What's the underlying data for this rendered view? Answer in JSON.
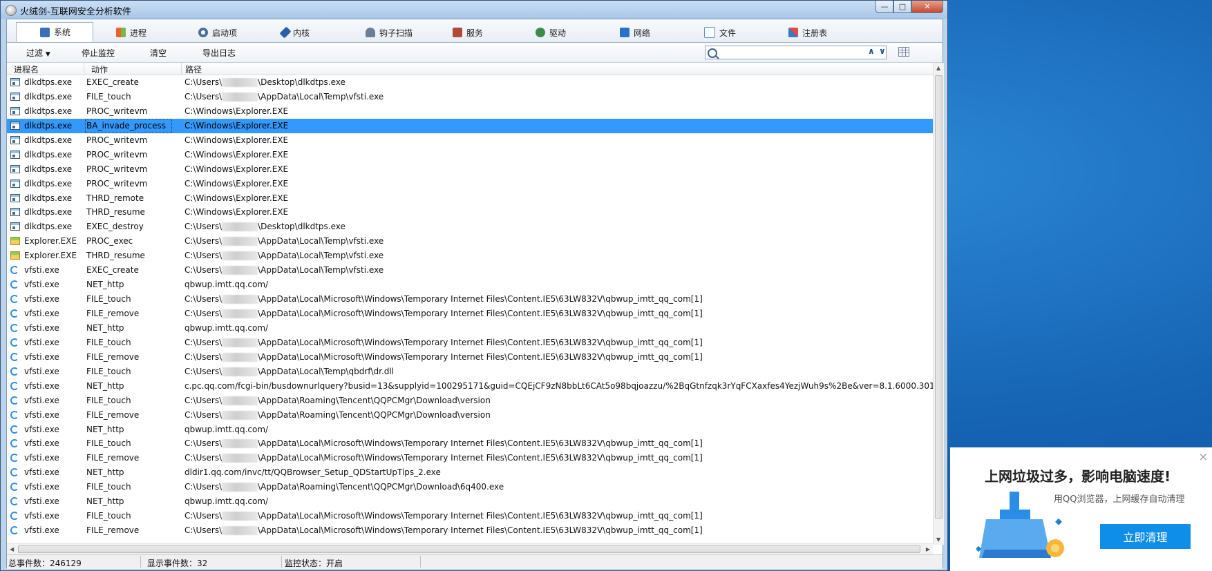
{
  "window": {
    "title": "火绒剑-互联网安全分析软件"
  },
  "tabs": [
    {
      "label": "系统",
      "icon": "system-icon",
      "color": "#3b6fb6"
    },
    {
      "label": "进程",
      "icon": "windows-logo-icon",
      "color": "#e8632a"
    },
    {
      "label": "启动项",
      "icon": "gear-icon",
      "color": "#4a6d9c"
    },
    {
      "label": "内核",
      "icon": "tools-icon",
      "color": "#2d5fa8"
    },
    {
      "label": "钩子扫描",
      "icon": "hook-scan-icon",
      "color": "#6a7f96"
    },
    {
      "label": "服务",
      "icon": "service-icon",
      "color": "#b04b3a"
    },
    {
      "label": "驱动",
      "icon": "driver-icon",
      "color": "#3e8a4a"
    },
    {
      "label": "网络",
      "icon": "network-icon",
      "color": "#2a72c4"
    },
    {
      "label": "文件",
      "icon": "file-icon",
      "color": "#5c8fc8"
    },
    {
      "label": "注册表",
      "icon": "registry-icon",
      "color": "#3a78c8"
    }
  ],
  "toolbar": {
    "filter_label": "过滤",
    "stop_label": "停止监控",
    "clear_label": "清空",
    "export_label": "导出日志",
    "search_value": "",
    "up_label": "∧",
    "down_label": "∨"
  },
  "columns": {
    "process": "进程名",
    "action": "动作",
    "path": "路径"
  },
  "rows": [
    {
      "icon": "exe",
      "proc": "dlkdtps.exe",
      "action": "EXEC_create",
      "path": [
        "C:\\Users\\",
        "\\Desktop\\dlkdtps.exe"
      ]
    },
    {
      "icon": "exe",
      "proc": "dlkdtps.exe",
      "action": "FILE_touch",
      "path": [
        "C:\\Users\\",
        "\\AppData\\Local\\Temp\\vfsti.exe"
      ]
    },
    {
      "icon": "exe",
      "proc": "dlkdtps.exe",
      "action": "PROC_writevm",
      "path": [
        "C:\\Windows\\Explorer.EXE"
      ]
    },
    {
      "icon": "exe",
      "proc": "dlkdtps.exe",
      "action": "BA_invade_process",
      "path": [
        "C:\\Windows\\Explorer.EXE"
      ],
      "selected": true
    },
    {
      "icon": "exe",
      "proc": "dlkdtps.exe",
      "action": "PROC_writevm",
      "path": [
        "C:\\Windows\\Explorer.EXE"
      ]
    },
    {
      "icon": "exe",
      "proc": "dlkdtps.exe",
      "action": "PROC_writevm",
      "path": [
        "C:\\Windows\\Explorer.EXE"
      ]
    },
    {
      "icon": "exe",
      "proc": "dlkdtps.exe",
      "action": "PROC_writevm",
      "path": [
        "C:\\Windows\\Explorer.EXE"
      ]
    },
    {
      "icon": "exe",
      "proc": "dlkdtps.exe",
      "action": "PROC_writevm",
      "path": [
        "C:\\Windows\\Explorer.EXE"
      ]
    },
    {
      "icon": "exe",
      "proc": "dlkdtps.exe",
      "action": "THRD_remote",
      "path": [
        "C:\\Windows\\Explorer.EXE"
      ]
    },
    {
      "icon": "exe",
      "proc": "dlkdtps.exe",
      "action": "THRD_resume",
      "path": [
        "C:\\Windows\\Explorer.EXE"
      ]
    },
    {
      "icon": "exe",
      "proc": "dlkdtps.exe",
      "action": "EXEC_destroy",
      "path": [
        "C:\\Users\\",
        "\\Desktop\\dlkdtps.exe"
      ]
    },
    {
      "icon": "explorer",
      "proc": "Explorer.EXE",
      "action": "PROC_exec",
      "path": [
        "C:\\Users\\",
        "\\AppData\\Local\\Temp\\vfsti.exe"
      ]
    },
    {
      "icon": "explorer",
      "proc": "Explorer.EXE",
      "action": "THRD_resume",
      "path": [
        "C:\\Users\\",
        "\\AppData\\Local\\Temp\\vfsti.exe"
      ]
    },
    {
      "icon": "vfsti",
      "proc": "vfsti.exe",
      "action": "EXEC_create",
      "path": [
        "C:\\Users\\",
        "\\AppData\\Local\\Temp\\vfsti.exe"
      ]
    },
    {
      "icon": "vfsti",
      "proc": "vfsti.exe",
      "action": "NET_http",
      "path": [
        "qbwup.imtt.qq.com/"
      ]
    },
    {
      "icon": "vfsti",
      "proc": "vfsti.exe",
      "action": "FILE_touch",
      "path": [
        "C:\\Users\\",
        "\\AppData\\Local\\Microsoft\\Windows\\Temporary Internet Files\\Content.IE5\\63LW832V\\qbwup_imtt_qq_com[1]"
      ]
    },
    {
      "icon": "vfsti",
      "proc": "vfsti.exe",
      "action": "FILE_remove",
      "path": [
        "C:\\Users\\",
        "\\AppData\\Local\\Microsoft\\Windows\\Temporary Internet Files\\Content.IE5\\63LW832V\\qbwup_imtt_qq_com[1]"
      ]
    },
    {
      "icon": "vfsti",
      "proc": "vfsti.exe",
      "action": "NET_http",
      "path": [
        "qbwup.imtt.qq.com/"
      ]
    },
    {
      "icon": "vfsti",
      "proc": "vfsti.exe",
      "action": "FILE_touch",
      "path": [
        "C:\\Users\\",
        "\\AppData\\Local\\Microsoft\\Windows\\Temporary Internet Files\\Content.IE5\\63LW832V\\qbwup_imtt_qq_com[1]"
      ]
    },
    {
      "icon": "vfsti",
      "proc": "vfsti.exe",
      "action": "FILE_remove",
      "path": [
        "C:\\Users\\",
        "\\AppData\\Local\\Microsoft\\Windows\\Temporary Internet Files\\Content.IE5\\63LW832V\\qbwup_imtt_qq_com[1]"
      ]
    },
    {
      "icon": "vfsti",
      "proc": "vfsti.exe",
      "action": "FILE_touch",
      "path": [
        "C:\\Users\\",
        "\\AppData\\Local\\Temp\\qbdrf\\dr.dll"
      ]
    },
    {
      "icon": "vfsti",
      "proc": "vfsti.exe",
      "action": "NET_http",
      "path": [
        "c.pc.qq.com/fcgi-bin/busdownurlquery?busid=13&supplyid=100295171&guid=CQEjCF9zN8bbLt6CAt5o98bqjoazzu/%2BqGtnfzqk3rYqFCXaxfes4YezjWuh9s%2Be&ver=8.1.6000.301"
      ]
    },
    {
      "icon": "vfsti",
      "proc": "vfsti.exe",
      "action": "FILE_touch",
      "path": [
        "C:\\Users\\",
        "\\AppData\\Roaming\\Tencent\\QQPCMgr\\Download\\version"
      ]
    },
    {
      "icon": "vfsti",
      "proc": "vfsti.exe",
      "action": "FILE_remove",
      "path": [
        "C:\\Users\\",
        "\\AppData\\Roaming\\Tencent\\QQPCMgr\\Download\\version"
      ]
    },
    {
      "icon": "vfsti",
      "proc": "vfsti.exe",
      "action": "NET_http",
      "path": [
        "qbwup.imtt.qq.com/"
      ]
    },
    {
      "icon": "vfsti",
      "proc": "vfsti.exe",
      "action": "FILE_touch",
      "path": [
        "C:\\Users\\",
        "\\AppData\\Local\\Microsoft\\Windows\\Temporary Internet Files\\Content.IE5\\63LW832V\\qbwup_imtt_qq_com[1]"
      ]
    },
    {
      "icon": "vfsti",
      "proc": "vfsti.exe",
      "action": "FILE_remove",
      "path": [
        "C:\\Users\\",
        "\\AppData\\Local\\Microsoft\\Windows\\Temporary Internet Files\\Content.IE5\\63LW832V\\qbwup_imtt_qq_com[1]"
      ]
    },
    {
      "icon": "vfsti",
      "proc": "vfsti.exe",
      "action": "NET_http",
      "path": [
        "dldir1.qq.com/invc/tt/QQBrowser_Setup_QDStartUpTips_2.exe"
      ]
    },
    {
      "icon": "vfsti",
      "proc": "vfsti.exe",
      "action": "FILE_touch",
      "path": [
        "C:\\Users\\",
        "\\AppData\\Roaming\\Tencent\\QQPCMgr\\Download\\6q400.exe"
      ]
    },
    {
      "icon": "vfsti",
      "proc": "vfsti.exe",
      "action": "NET_http",
      "path": [
        "qbwup.imtt.qq.com/"
      ]
    },
    {
      "icon": "vfsti",
      "proc": "vfsti.exe",
      "action": "FILE_touch",
      "path": [
        "C:\\Users\\",
        "\\AppData\\Local\\Microsoft\\Windows\\Temporary Internet Files\\Content.IE5\\63LW832V\\qbwup_imtt_qq_com[1]"
      ]
    },
    {
      "icon": "vfsti",
      "proc": "vfsti.exe",
      "action": "FILE_remove",
      "path": [
        "C:\\Users\\",
        "\\AppData\\Local\\Microsoft\\Windows\\Temporary Internet Files\\Content.IE5\\63LW832V\\qbwup_imtt_qq_com[1]"
      ]
    }
  ],
  "status": {
    "total": "总事件数：246129",
    "shown": "显示事件数：32",
    "monitor": "监控状态：开启"
  },
  "popup": {
    "title": "上网垃圾过多，影响电脑速度!",
    "subtitle": "用QQ浏览器，上网缓存自动清理",
    "button": "立即清理",
    "close": "×",
    "accent": "#0e8ee8"
  }
}
